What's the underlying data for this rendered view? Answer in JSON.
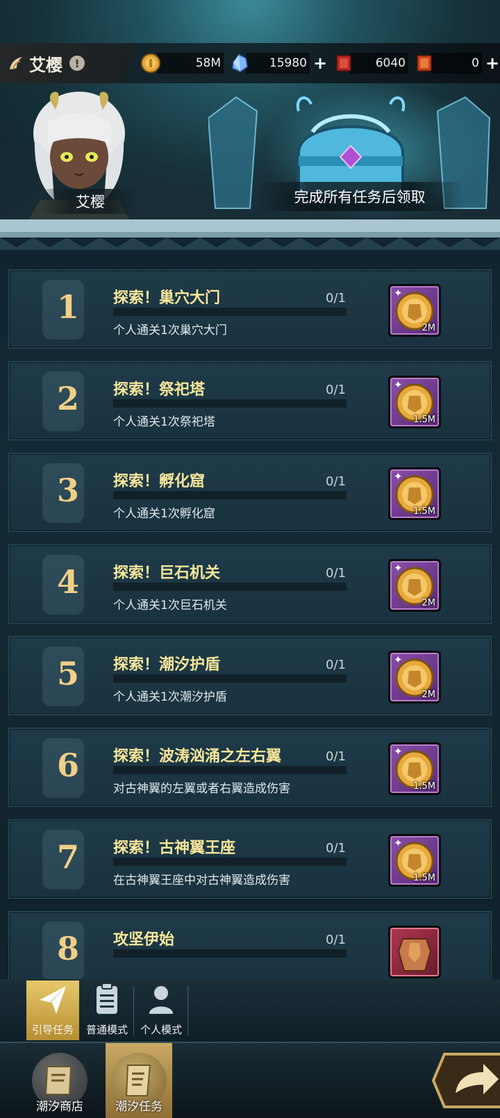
{
  "hero": {
    "name": "艾樱",
    "portrait_label": "艾樱"
  },
  "currencies": [
    {
      "icon": "gold-coin-icon",
      "value": "58M",
      "plus": false
    },
    {
      "icon": "crystal-icon",
      "value": "15980",
      "plus": true
    },
    {
      "icon": "red-ticket-icon",
      "value": "6040",
      "plus": false
    },
    {
      "icon": "orange-ticket-icon",
      "value": "0",
      "plus": true
    }
  ],
  "plus_symbol": "+",
  "chest_label": "完成所有任务后领取",
  "tasks": [
    {
      "num": "1",
      "title": "探索！巢穴大门",
      "count": "0/1",
      "desc": "个人通关1次巢穴大门",
      "reward": "2M",
      "reward_icon": "gold-coin-icon"
    },
    {
      "num": "2",
      "title": "探索！祭祀塔",
      "count": "0/1",
      "desc": "个人通关1次祭祀塔",
      "reward": "1.5M",
      "reward_icon": "gold-coin-icon"
    },
    {
      "num": "3",
      "title": "探索！孵化窟",
      "count": "0/1",
      "desc": "个人通关1次孵化窟",
      "reward": "1.5M",
      "reward_icon": "gold-coin-icon"
    },
    {
      "num": "4",
      "title": "探索！巨石机关",
      "count": "0/1",
      "desc": "个人通关1次巨石机关",
      "reward": "2M",
      "reward_icon": "gold-coin-icon"
    },
    {
      "num": "5",
      "title": "探索！潮汐护盾",
      "count": "0/1",
      "desc": "个人通关1次潮汐护盾",
      "reward": "2M",
      "reward_icon": "gold-coin-icon"
    },
    {
      "num": "6",
      "title": "探索！波涛汹涌之左右翼",
      "count": "0/1",
      "desc": "对古神翼的左翼或者右翼造成伤害",
      "reward": "1.5M",
      "reward_icon": "gold-coin-icon"
    },
    {
      "num": "7",
      "title": "探索！古神翼王座",
      "count": "0/1",
      "desc": "在古神翼王座中对古神翼造成伤害",
      "reward": "1.5M",
      "reward_icon": "gold-coin-icon"
    },
    {
      "num": "8",
      "title": "攻坚伊始",
      "count": "0/1",
      "desc": "",
      "reward": "",
      "reward_icon": "armor-item-icon"
    }
  ],
  "modes": [
    {
      "label": "引导任务",
      "icon": "paper-plane-icon",
      "active": true
    },
    {
      "label": "普通模式",
      "icon": "clipboard-icon",
      "active": false
    },
    {
      "label": "个人模式",
      "icon": "person-icon",
      "active": false
    }
  ],
  "nav": [
    {
      "label": "潮汐商店",
      "icon": "scroll-shop-icon",
      "active": false
    },
    {
      "label": "潮汐任务",
      "icon": "scroll-quest-icon",
      "active": true
    }
  ],
  "colors": {
    "accent_gold": "#f0cf87",
    "title_yellow": "#f6e79a",
    "reward_purple": "#7b3f99",
    "active_tab": "#d4b158"
  }
}
